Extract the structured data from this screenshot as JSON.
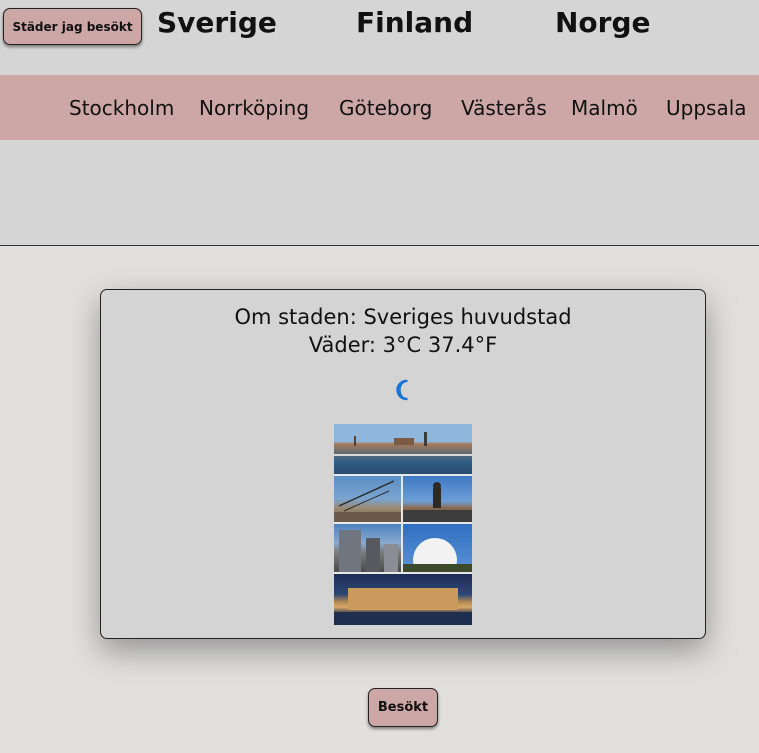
{
  "header": {
    "visited_button": "Städer jag besökt",
    "countries": [
      "Sverige",
      "Finland",
      "Norge"
    ]
  },
  "cities": [
    "Stockholm",
    "Norrköping",
    "Göteborg",
    "Västerås",
    "Malmö",
    "Uppsala"
  ],
  "card": {
    "about": "Om staden: Sveriges huvudstad",
    "weather": "Väder: 3°C 37.4°F",
    "weather_icon": "moon-icon",
    "icon_color": "#1a73d9"
  },
  "footer": {
    "visited_label": "Besökt"
  },
  "colors": {
    "accent": "#cda6a6",
    "header_bg": "#d5d5d5",
    "page_bg": "#e1e0df"
  }
}
